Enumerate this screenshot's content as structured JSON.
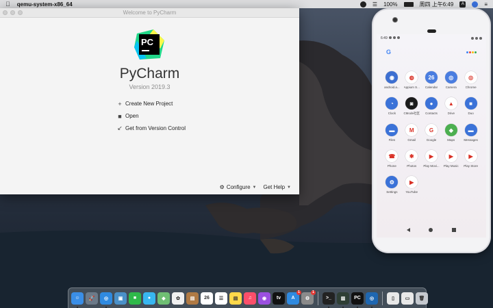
{
  "menubar": {
    "app_name": "qemu-system-x86_64",
    "battery_percent": "100%",
    "clock": "周四 上午6:49",
    "input_source": "A"
  },
  "pycharm": {
    "window_title": "Welcome to PyCharm",
    "logo_text": "PC",
    "product_name": "PyCharm",
    "version": "Version 2019.3",
    "actions": [
      {
        "label": "Create New Project",
        "icon": "plus-icon"
      },
      {
        "label": "Open",
        "icon": "folder-icon"
      },
      {
        "label": "Get from Version Control",
        "icon": "vcs-arrow-icon"
      }
    ],
    "configure_label": "Configure",
    "get_help_label": "Get Help"
  },
  "android": {
    "status_time": "6:49",
    "google_letter": "G",
    "apps": [
      {
        "label": "android.a...",
        "color": "#3d6fd1",
        "glyph": "◉"
      },
      {
        "label": "Appium S...",
        "color": "#ffffff",
        "glyph": "◍"
      },
      {
        "label": "Calendar",
        "color": "#4a7de0",
        "glyph": "26"
      },
      {
        "label": "Camera",
        "color": "#4a7de0",
        "glyph": "◎"
      },
      {
        "label": "Chrome",
        "color": "#ffffff",
        "glyph": "◎"
      },
      {
        "label": "Clock",
        "color": "#3b72d8",
        "glyph": "◔"
      },
      {
        "label": "CMode社区",
        "color": "#1b1b1b",
        "glyph": "◙"
      },
      {
        "label": "Contacts",
        "color": "#3b72d8",
        "glyph": "●"
      },
      {
        "label": "Drive",
        "color": "#ffffff",
        "glyph": "▲"
      },
      {
        "label": "Duo",
        "color": "#3b72d8",
        "glyph": "■"
      },
      {
        "label": "Files",
        "color": "#3b72d8",
        "glyph": "▬"
      },
      {
        "label": "Gmail",
        "color": "#ffffff",
        "glyph": "M"
      },
      {
        "label": "Google",
        "color": "#ffffff",
        "glyph": "G"
      },
      {
        "label": "Maps",
        "color": "#4caf50",
        "glyph": "◆"
      },
      {
        "label": "Messages",
        "color": "#3b72d8",
        "glyph": "▬"
      },
      {
        "label": "Phone",
        "color": "#ffffff",
        "glyph": "☎"
      },
      {
        "label": "Photos",
        "color": "#ffffff",
        "glyph": "✱"
      },
      {
        "label": "Play Movi...",
        "color": "#ffffff",
        "glyph": "▶"
      },
      {
        "label": "Play Music",
        "color": "#ffffff",
        "glyph": "▶"
      },
      {
        "label": "Play Store",
        "color": "#ffffff",
        "glyph": "▶"
      },
      {
        "label": "Settings",
        "color": "#3b72d8",
        "glyph": "⚙"
      },
      {
        "label": "YouTube",
        "color": "#ffffff",
        "glyph": "▶"
      }
    ]
  },
  "dock": {
    "apps": [
      {
        "name": "finder",
        "color": "#3a8ee6",
        "glyph": "☺",
        "running": true
      },
      {
        "name": "launchpad",
        "color": "#6c7a89",
        "glyph": "🚀",
        "running": false
      },
      {
        "name": "safari",
        "color": "#2f8ae0",
        "glyph": "◎",
        "running": true
      },
      {
        "name": "preview",
        "color": "#4a90c8",
        "glyph": "▣",
        "running": false
      },
      {
        "name": "facetime",
        "color": "#2fb94a",
        "glyph": "■",
        "running": false
      },
      {
        "name": "messages",
        "color": "#38b6f0",
        "glyph": "●",
        "running": false
      },
      {
        "name": "maps",
        "color": "#6fbf73",
        "glyph": "◆",
        "running": false
      },
      {
        "name": "photos",
        "color": "#f1f1f1",
        "glyph": "✿",
        "running": false
      },
      {
        "name": "notes-app",
        "color": "#b07a44",
        "glyph": "▤",
        "running": false
      },
      {
        "name": "calendar",
        "color": "#ffffff",
        "glyph": "26",
        "running": false
      },
      {
        "name": "reminders",
        "color": "#ffffff",
        "glyph": "☰",
        "running": false
      },
      {
        "name": "notes",
        "color": "#ffd84a",
        "glyph": "▤",
        "running": false
      },
      {
        "name": "music",
        "color": "#fb4f6a",
        "glyph": "♫",
        "running": false
      },
      {
        "name": "podcasts",
        "color": "#9b4fe0",
        "glyph": "◉",
        "running": false
      },
      {
        "name": "tv",
        "color": "#111111",
        "glyph": "tv",
        "running": false
      },
      {
        "name": "app-store",
        "color": "#2f8ae0",
        "glyph": "A",
        "running": false,
        "badge": "1"
      },
      {
        "name": "system-preferences",
        "color": "#8a8a8a",
        "glyph": "⚙",
        "running": false,
        "badge": "1"
      }
    ],
    "running_apps": [
      {
        "name": "terminal",
        "color": "#222222",
        "glyph": ">_",
        "running": true
      },
      {
        "name": "android-studio-emulator",
        "color": "#2f3f35",
        "glyph": "▥",
        "running": true
      },
      {
        "name": "pycharm",
        "color": "#111111",
        "glyph": "PC",
        "running": true
      },
      {
        "name": "qemu",
        "color": "#1f67b1",
        "glyph": "◎",
        "running": true
      }
    ],
    "trailing": [
      {
        "name": "document",
        "color": "#e8e8e8",
        "glyph": "▯",
        "running": false
      },
      {
        "name": "screenshot",
        "color": "#e8e8e8",
        "glyph": "▭",
        "running": false
      },
      {
        "name": "trash",
        "color": "#c5c9cf",
        "glyph": "🗑",
        "running": false
      }
    ]
  }
}
